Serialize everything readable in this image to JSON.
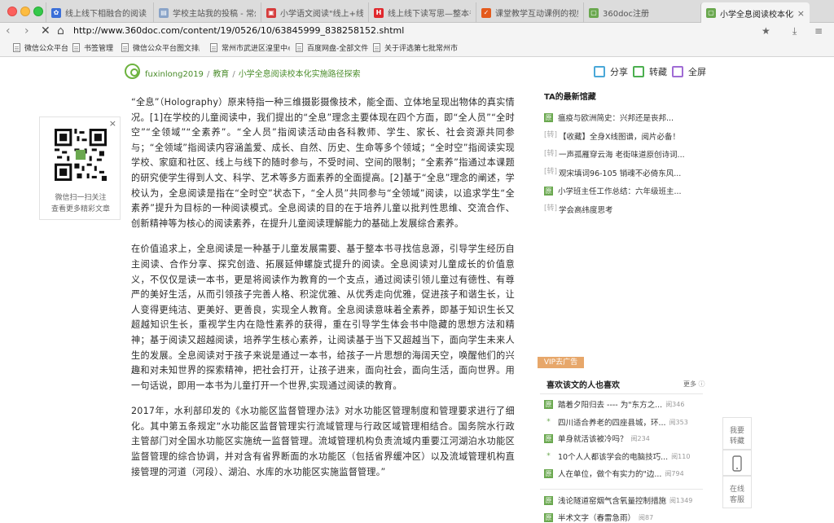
{
  "browser": {
    "tabs": [
      {
        "label": "线上线下相融合的阅读",
        "icon": "tab-favicon-blue",
        "color": "#3b6fd8",
        "glyph": "✿"
      },
      {
        "label": "学校主站我的投稿 - 常州",
        "icon": "tab-favicon-doc",
        "color": "#8aa4c8",
        "glyph": "▤"
      },
      {
        "label": "小学语文阅读\"线上+线",
        "icon": "tab-favicon-red",
        "color": "#d63c3c",
        "glyph": "▣"
      },
      {
        "label": "线上线下读写思—整本书",
        "icon": "tab-favicon-red",
        "color": "#e0282d",
        "glyph": "H"
      },
      {
        "label": "课堂教学互动课例的视频",
        "icon": "tab-favicon-orange",
        "color": "#e45a1c",
        "glyph": "✓"
      },
      {
        "label": "360doc注册",
        "icon": "tab-favicon-green",
        "color": "#6aa84f",
        "glyph": "▢"
      },
      {
        "label": "小学全息阅读校本化实施",
        "icon": "tab-favicon-green",
        "color": "#6aa84f",
        "glyph": "▢"
      }
    ],
    "url": "http://www.360doc.com/content/19/0526/10/63845999_838258152.shtml",
    "bookmarks": [
      "微信公众平台",
      "书签管理",
      "微信公众平台图文排版",
      "常州市武进区湟里中心",
      "百度网盘-全部文件",
      "关于评选第七批常州市"
    ]
  },
  "header": {
    "user": "fuxinlong2019",
    "category": "教育",
    "title": "小学全息阅读校本化实施路径探索",
    "share": "分享",
    "repost": "转藏",
    "fullscreen": "全屏"
  },
  "qr_widget": {
    "close": "×",
    "line1": "微信扫一扫关注",
    "line2": "查看更多精彩文章"
  },
  "article": {
    "paragraphs": [
      "“全息”（Holography）原来特指一种三维摄影摄像技术，能全面、立体地呈现出物体的真实情况。[1]在学校的儿童阅读中，我们提出的“全息”理念主要体现在四个方面，即“全人员”“全时空”“全领域”“全素养”。“全人员”指阅读活动由各科教师、学生、家长、社会资源共同参与；“全领域”指阅读内容涵盖爱、成长、自然、历史、生命等多个领域；“全时空”指阅读实现学校、家庭和社区、线上与线下的随时参与，不受时间、空间的限制；“全素养”指通过本课题的研究使学生得到人文、科学、艺术等多方面素养的全面提高。[2]基于“全息”理念的阐述，学校认为，全息阅读是指在“全时空”状态下，“全人员”共同参与“全领域”阅读，以追求学生“全素养”提升为目标的一种阅读模式。全息阅读的目的在于培养儿童以批判性思维、交流合作、创新精神等为核心的阅读素养，在提升儿童阅读理解能力的基础上发展综合素养。",
      "在价值追求上，全息阅读是一种基于儿童发展需要、基于整本书寻找信息源，引导学生经历自主阅读、合作分享、探究创造、拓展延伸螺旋式提升的阅读。全息阅读对儿童成长的价值意义，不仅仅是读一本书，更是将阅读作为教育的一个支点，通过阅读引领儿童过有德性、有尊严的美好生活，从而引领孩子完善人格、积淀优雅、从优秀走向优雅，促进孩子和谐生长，让人变得更纯洁、更美好、更善良，实现全人教育。全息阅读意味着全素养，即基于知识生长又超越知识生长，重视学生内在隐性素养的获得，重在引导学生体会书中隐藏的思想方法和精神；基于阅读又超越阅读，培养学生核心素养，让阅读基于当下又超越当下，面向学生未来人生的发展。全息阅读对于孩子来说是通过一本书，给孩子一片思想的海阔天空，唤醒他们的兴趣和对未知世界的探索精神，把社会打开，让孩子进来，面向社会，面向生活，面向世界。用一句话说，即用一本书为儿童打开一个世界,实现通过阅读的教育。",
      "2017年，水利部印发的《水功能区监督管理办法》对水功能区管理制度和管理要求进行了细化。其中第五条规定“水功能区监督管理实行流域管理与行政区域管理相结合。国务院水行政主管部门对全国水功能区实施统一监督管理。流域管理机构负责流域内重要江河湖泊水功能区监督管理的综合协调，并对含有省界断面的水功能区（包括省界缓冲区）以及流域管理机构直接管理的河道（河段）、湖泊、水库的水功能区实施监督管理。”"
    ]
  },
  "sidebar": {
    "latest_title": "TA的最新馆藏",
    "latest": [
      {
        "tag": "原",
        "text": "瘟疫与欧洲简史：兴邦还是丧邦..."
      },
      {
        "tag": "[转]",
        "text": "【收藏】全身X线图谱，阅片必备！"
      },
      {
        "tag": "[转]",
        "text": "一声孤雁穿云海 老街味道原创诗词..."
      },
      {
        "tag": "[转]",
        "text": "观宋填词96-105 销魂不必倚东风..."
      },
      {
        "tag": "原",
        "text": "小学班主任工作总结：六年级班主..."
      },
      {
        "tag": "[转]",
        "text": "学会高纬度思考"
      }
    ],
    "vip": "VIP去广告",
    "like_title": "喜欢该文的人也喜欢",
    "more": "更多",
    "like": [
      {
        "mark": "原",
        "text": "踏着夕阳归去 ---- 为\"东方之...",
        "reads": "阅346"
      },
      {
        "mark": "*",
        "text": "四川适合养老的四座县城，环...",
        "reads": "阅353"
      },
      {
        "mark": "原",
        "text": "单身就活该被冷吗？",
        "reads": "阅234"
      },
      {
        "mark": "*",
        "text": "10个人人都该学会的电脑技巧...",
        "reads": "阅110"
      },
      {
        "mark": "原",
        "text": "人在单位，做个有实力的\"边...",
        "reads": "阅794"
      },
      {
        "mark": "原",
        "text": "浅论隧道窑烟气含氧量控制措施",
        "reads": "阅1349"
      },
      {
        "mark": "原",
        "text": "半术文字（春雷急雨）",
        "reads": "阅87"
      }
    ]
  },
  "floating": {
    "repost_line1": "我要",
    "repost_line2": "转藏",
    "service_line1": "在线",
    "service_line2": "客服"
  }
}
